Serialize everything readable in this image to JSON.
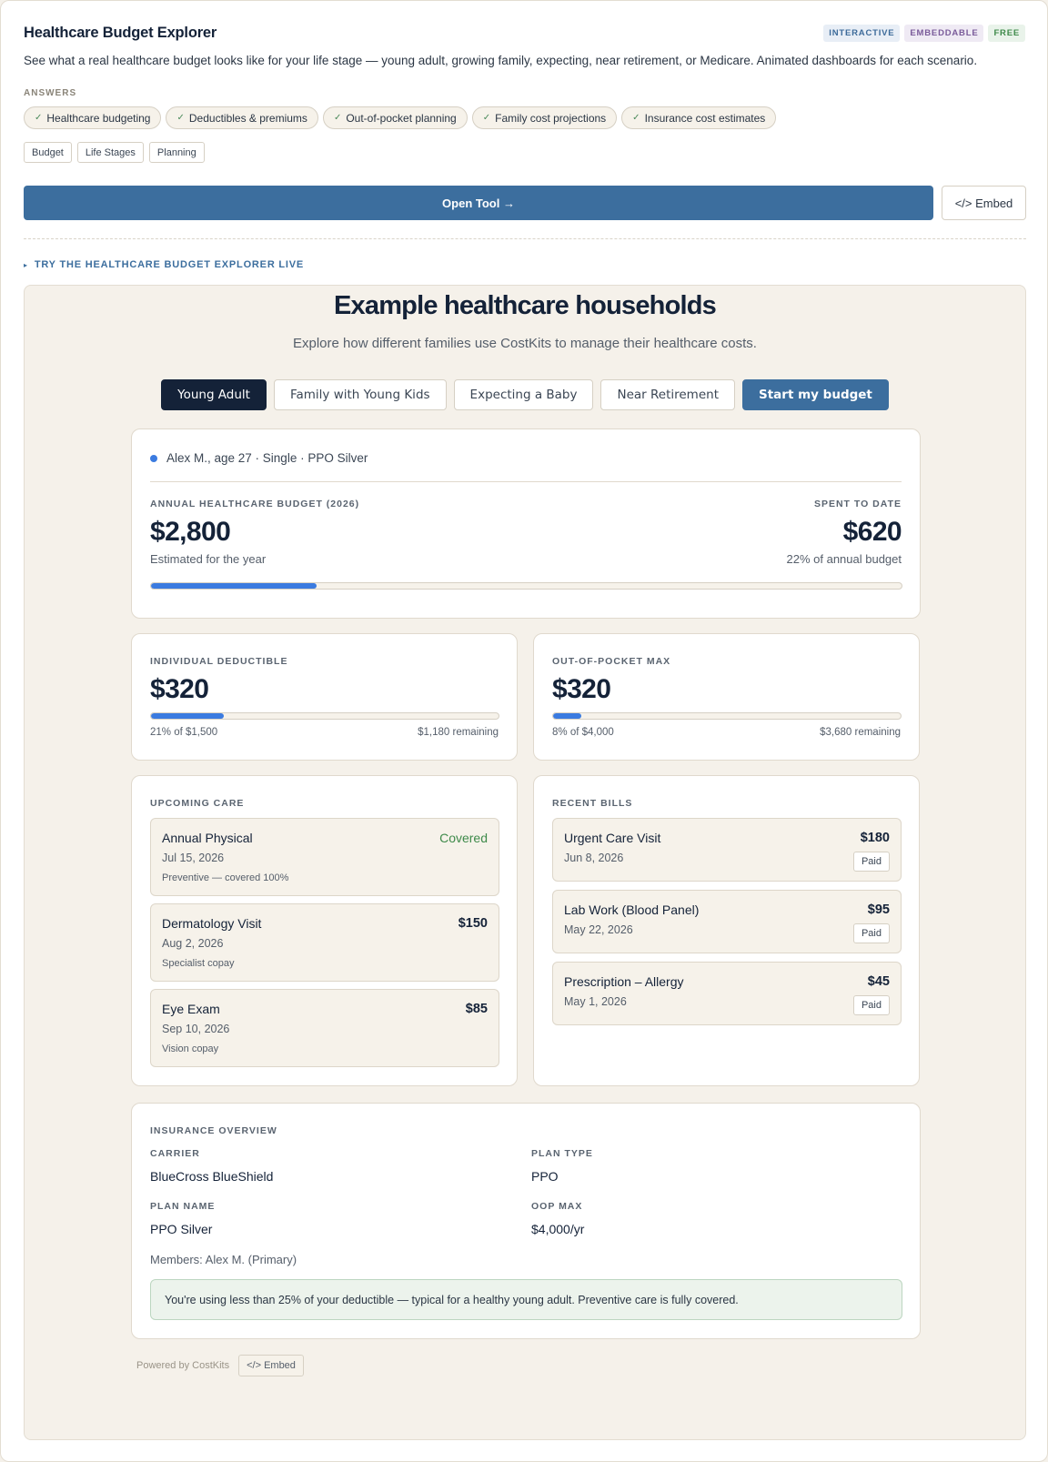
{
  "header": {
    "title": "Healthcare Budget Explorer",
    "badges": [
      "INTERACTIVE",
      "EMBEDDABLE",
      "FREE"
    ],
    "description": "See what a real healthcare budget looks like for your life stage — young adult, growing family, expecting, near retirement, or Medicare. Animated dashboards for each scenario."
  },
  "answers": {
    "label": "ANSWERS",
    "check": "✓",
    "items": [
      "Healthcare budgeting",
      "Deductibles & premiums",
      "Out-of-pocket planning",
      "Family cost projections",
      "Insurance cost estimates"
    ]
  },
  "tags": [
    "Budget",
    "Life Stages",
    "Planning"
  ],
  "actions": {
    "open_label": "Open Tool →",
    "embed_label": "</> Embed"
  },
  "try_live": {
    "icon": "▸",
    "label": "TRY THE HEALTHCARE BUDGET EXPLORER LIVE"
  },
  "demo": {
    "title": "Example healthcare households",
    "subtitle": "Explore how different families use CostKits to manage their healthcare costs.",
    "tabs": [
      "Young Adult",
      "Family with Young Kids",
      "Expecting a Baby",
      "Near Retirement"
    ],
    "cta_label": "Start my budget",
    "person": "Alex M., age 27 · Single · PPO Silver",
    "budget": {
      "label": "ANNUAL HEALTHCARE BUDGET (2026)",
      "value": "$2,800",
      "note": "Estimated for the year",
      "spent_label": "SPENT TO DATE",
      "spent_value": "$620",
      "spent_note": "22% of annual budget",
      "progress": 0.22
    },
    "deductible": {
      "label": "INDIVIDUAL DEDUCTIBLE",
      "value": "$320",
      "progress": 0.21,
      "left": "21% of $1,500",
      "right": "$1,180 remaining"
    },
    "oop": {
      "label": "OUT-OF-POCKET MAX",
      "value": "$320",
      "progress": 0.08,
      "left": "8% of $4,000",
      "right": "$3,680 remaining"
    },
    "upcoming": {
      "label": "UPCOMING CARE",
      "items": [
        {
          "name": "Annual Physical",
          "date": "Jul 15, 2026",
          "note": "Preventive — covered 100%",
          "amount": "Covered"
        },
        {
          "name": "Dermatology Visit",
          "date": "Aug 2, 2026",
          "note": "Specialist copay",
          "amount": "$150"
        },
        {
          "name": "Eye Exam",
          "date": "Sep 10, 2026",
          "note": "Vision copay",
          "amount": "$85"
        }
      ]
    },
    "bills": {
      "label": "RECENT BILLS",
      "items": [
        {
          "name": "Urgent Care Visit",
          "date": "Jun 8, 2026",
          "amount": "$180",
          "status": "Paid"
        },
        {
          "name": "Lab Work (Blood Panel)",
          "date": "May 22, 2026",
          "amount": "$95",
          "status": "Paid"
        },
        {
          "name": "Prescription – Allergy",
          "date": "May 1, 2026",
          "amount": "$45",
          "status": "Paid"
        }
      ]
    },
    "insurance": {
      "label": "INSURANCE OVERVIEW",
      "carrier_label": "CARRIER",
      "carrier": "BlueCross BlueShield",
      "plan_type_label": "PLAN TYPE",
      "plan_type": "PPO",
      "plan_name_label": "PLAN NAME",
      "plan_name": "PPO Silver",
      "oop_label": "OOP MAX",
      "oop": "$4,000/yr",
      "members": "Members: Alex M. (Primary)",
      "note": "You're using less than 25% of your deductible — typical for a healthy young adult. Preventive care is fully covered."
    },
    "powered_by": "Powered by CostKits",
    "small_embed": "</> Embed"
  },
  "colors": {
    "primary": "#3c6e9e",
    "navy": "#142238",
    "accent_blue": "#3b7be0",
    "covered_green": "#3e8a4a"
  }
}
